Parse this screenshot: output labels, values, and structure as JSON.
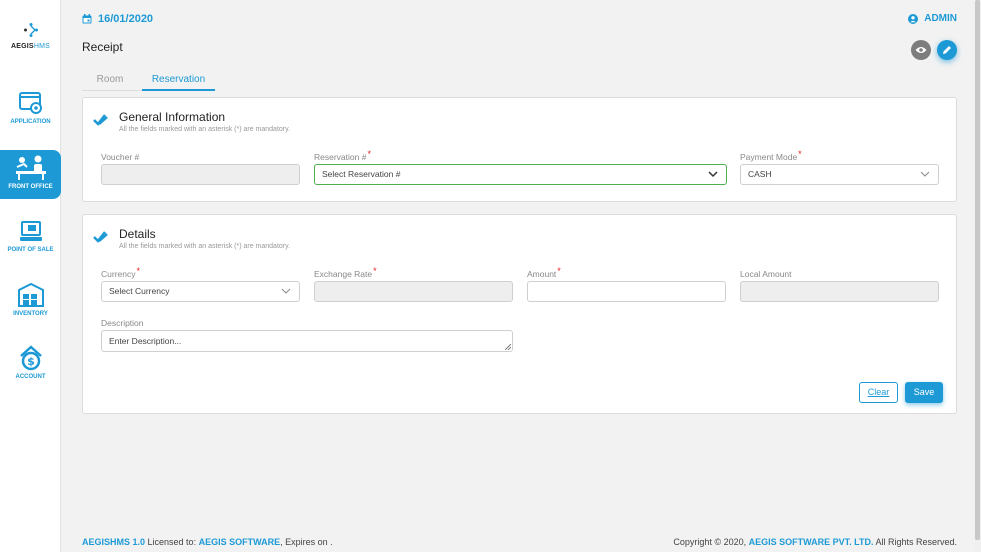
{
  "app": {
    "logo_main": "AEGIS",
    "logo_accent": "HMS"
  },
  "sidebar": {
    "items": [
      {
        "label": "APPLICATION",
        "icon": "application-icon",
        "active": false
      },
      {
        "label": "FRONT OFFICE",
        "icon": "front-office-icon",
        "active": true
      },
      {
        "label": "POINT OF SALE",
        "icon": "point-of-sale-icon",
        "active": false
      },
      {
        "label": "INVENTORY",
        "icon": "inventory-icon",
        "active": false
      },
      {
        "label": "ACCOUNT",
        "icon": "account-icon",
        "active": false
      }
    ]
  },
  "header": {
    "date": "16/01/2020",
    "user": "ADMIN",
    "page_title": "Receipt"
  },
  "tabs": [
    {
      "label": "Room",
      "active": false
    },
    {
      "label": "Reservation",
      "active": true
    }
  ],
  "general": {
    "title": "General Information",
    "subtitle": "All the fields marked with an asterisk (*) are mandatory.",
    "voucher_label": "Voucher #",
    "voucher_value": "",
    "reservation_label": "Reservation #",
    "reservation_placeholder": "Select Reservation #",
    "payment_label": "Payment Mode",
    "payment_value": "CASH"
  },
  "details": {
    "title": "Details",
    "subtitle": "All the fields marked with an asterisk (*) are mandatory.",
    "currency_label": "Currency",
    "currency_placeholder": "Select Currency",
    "exchange_label": "Exchange Rate",
    "amount_label": "Amount",
    "local_label": "Local Amount",
    "description_label": "Description",
    "description_placeholder": "Enter Description...",
    "clear_label": "Clear",
    "save_label": "Save"
  },
  "footer": {
    "product": "AEGISHMS 1.0",
    "licensed_text": " Licensed to: ",
    "licensee": "AEGIS SOFTWARE",
    "expires_text": ", Expires on .",
    "copyright_text": "Copyright © 2020, ",
    "company": "AEGIS SOFTWARE PVT. LTD.",
    "rights_text": " All Rights Reserved."
  },
  "colors": {
    "accent": "#1d9ad6",
    "required": "#e02020",
    "focus": "#4caf50"
  }
}
